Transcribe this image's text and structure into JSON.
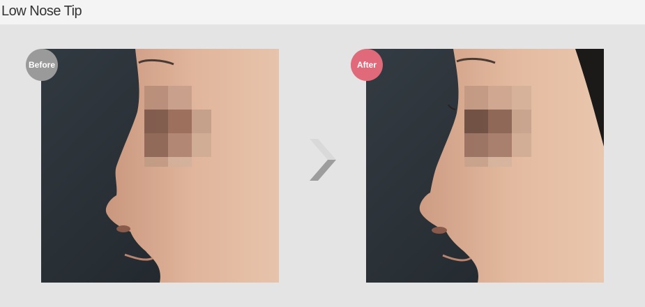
{
  "header": {
    "title": "Low Nose Tip"
  },
  "labels": {
    "before": "Before",
    "after": "After"
  },
  "colors": {
    "before_badge": "#9a9a9a",
    "after_badge": "#e06a7a",
    "background": "#e4e4e4",
    "header_bg": "#f4f4f4"
  },
  "icons": {
    "arrow": "chevron-right-icon"
  }
}
